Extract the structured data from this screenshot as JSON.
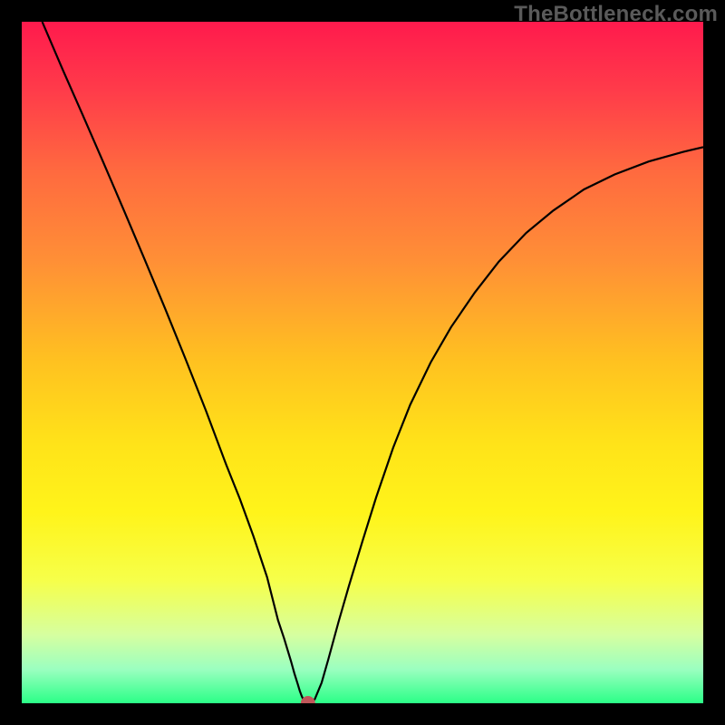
{
  "watermark": "TheBottleneck.com",
  "chart_data": {
    "type": "line",
    "title": "",
    "xlabel": "",
    "ylabel": "",
    "xlim": [
      0,
      1
    ],
    "ylim": [
      0,
      1
    ],
    "background_gradient": {
      "stops": [
        {
          "offset": 0.0,
          "color": "#ff1a4d"
        },
        {
          "offset": 0.1,
          "color": "#ff3b4a"
        },
        {
          "offset": 0.22,
          "color": "#ff6a3f"
        },
        {
          "offset": 0.35,
          "color": "#ff8f36"
        },
        {
          "offset": 0.5,
          "color": "#ffc220"
        },
        {
          "offset": 0.62,
          "color": "#ffe319"
        },
        {
          "offset": 0.72,
          "color": "#fff41a"
        },
        {
          "offset": 0.82,
          "color": "#f6ff4a"
        },
        {
          "offset": 0.9,
          "color": "#d6ffa0"
        },
        {
          "offset": 0.95,
          "color": "#9bffc0"
        },
        {
          "offset": 1.0,
          "color": "#2bff87"
        }
      ]
    },
    "series": [
      {
        "name": "curve",
        "color": "#000000",
        "width": 2.2,
        "x": [
          0.03,
          0.06,
          0.09,
          0.12,
          0.15,
          0.18,
          0.21,
          0.24,
          0.27,
          0.3,
          0.32,
          0.34,
          0.36,
          0.376,
          0.385,
          0.395,
          0.4,
          0.405,
          0.408,
          0.411,
          0.414,
          0.417,
          0.42,
          0.425,
          0.43,
          0.44,
          0.45,
          0.465,
          0.48,
          0.5,
          0.52,
          0.545,
          0.57,
          0.6,
          0.63,
          0.665,
          0.7,
          0.74,
          0.78,
          0.825,
          0.87,
          0.92,
          0.97,
          1.0
        ],
        "y": [
          1.0,
          0.93,
          0.862,
          0.793,
          0.723,
          0.652,
          0.58,
          0.506,
          0.43,
          0.35,
          0.3,
          0.245,
          0.185,
          0.122,
          0.095,
          0.062,
          0.044,
          0.028,
          0.018,
          0.01,
          0.004,
          0.001,
          0.0,
          0.001,
          0.006,
          0.03,
          0.065,
          0.12,
          0.172,
          0.238,
          0.302,
          0.375,
          0.438,
          0.5,
          0.552,
          0.603,
          0.648,
          0.69,
          0.723,
          0.754,
          0.776,
          0.795,
          0.809,
          0.816
        ]
      }
    ],
    "marker": {
      "x": 0.42,
      "y": 0.0,
      "color": "#c0575a",
      "radius": 8
    }
  }
}
